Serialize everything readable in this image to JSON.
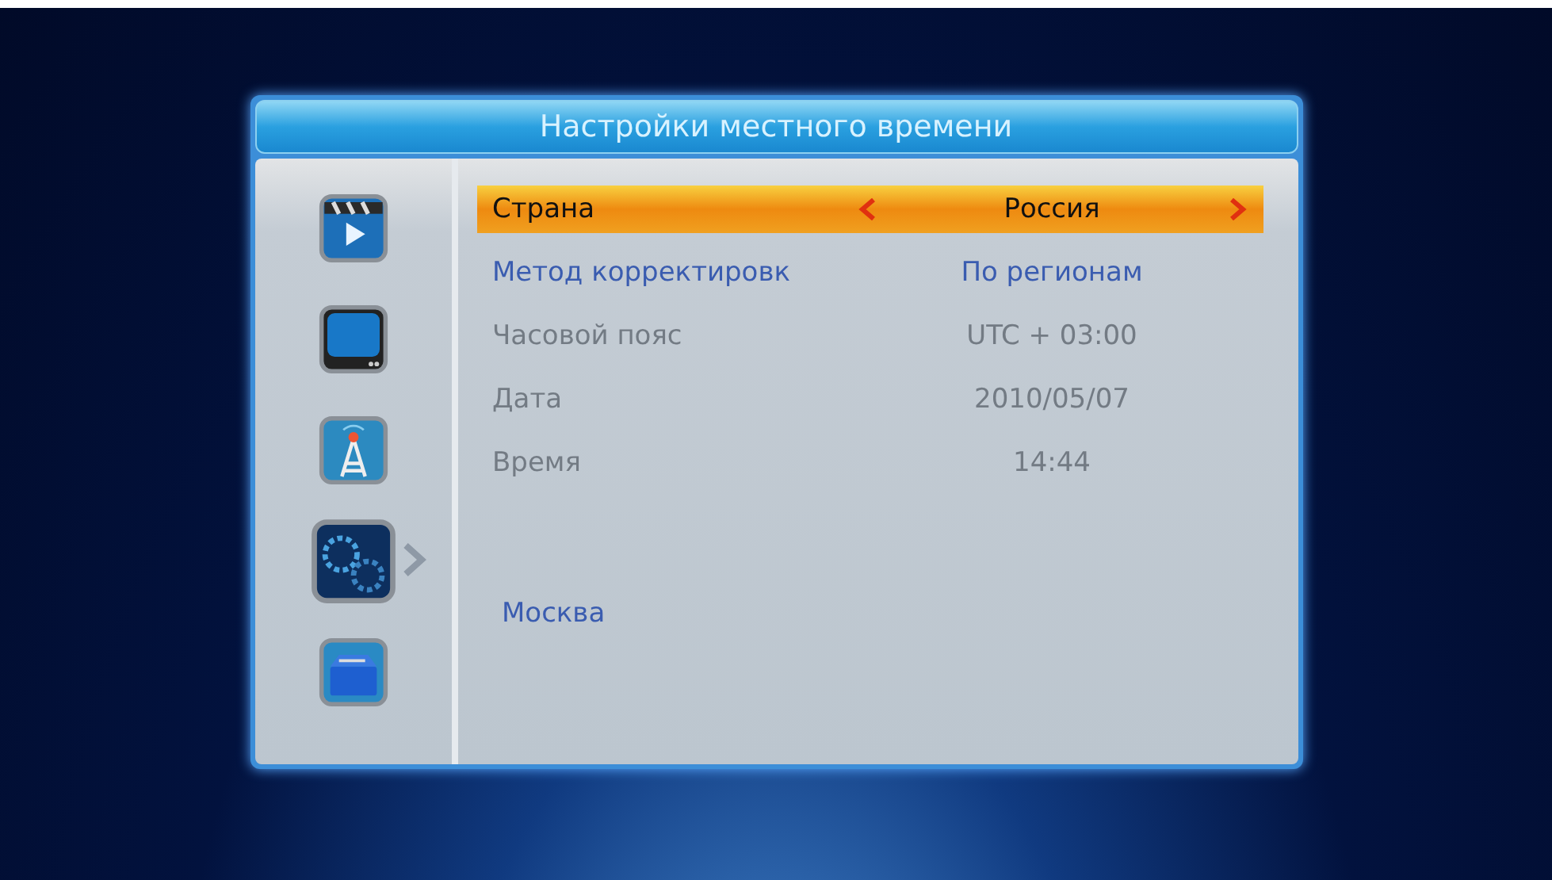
{
  "window": {
    "title": "Настройки местного времени"
  },
  "sidebar": {
    "items": [
      {
        "kind": "video",
        "selected": false
      },
      {
        "kind": "tv",
        "selected": false
      },
      {
        "kind": "antenna",
        "selected": false
      },
      {
        "kind": "settings",
        "selected": true
      },
      {
        "kind": "tools",
        "selected": false
      }
    ]
  },
  "settings": [
    {
      "label": "Страна",
      "value": "Россия",
      "selected": true,
      "disabled": false
    },
    {
      "label": "Метод корректировк",
      "value": "По регионам",
      "selected": false,
      "disabled": false
    },
    {
      "label": "Часовой пояс",
      "value": "UTC + 03:00",
      "selected": false,
      "disabled": true
    },
    {
      "label": "Дата",
      "value": "2010/05/07",
      "selected": false,
      "disabled": true
    },
    {
      "label": "Время",
      "value": "14:44",
      "selected": false,
      "disabled": true
    }
  ],
  "region": "Москва"
}
